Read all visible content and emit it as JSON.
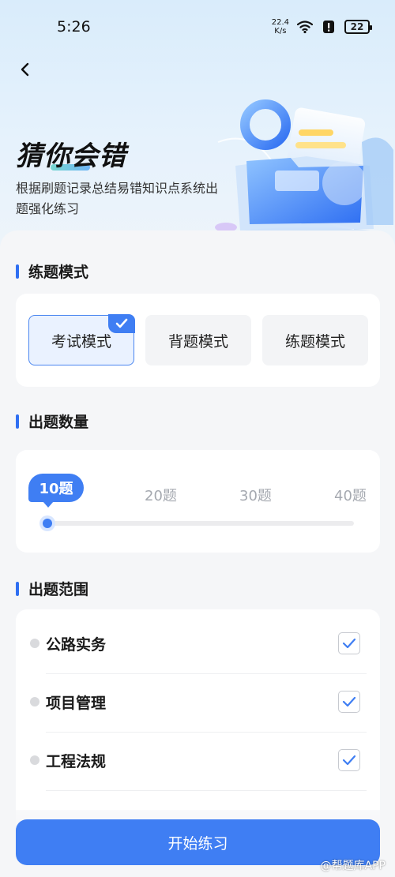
{
  "status_bar": {
    "time": "5:26",
    "net_speed_value": "22.4",
    "net_speed_unit": "K/s",
    "battery": "22"
  },
  "header": {
    "back_icon": "chevron-left-icon",
    "title": "猜你会错",
    "subtitle": "根据刷题记录总结易错知识点系统出题强化练习"
  },
  "practice_mode": {
    "title": "练题模式",
    "options": [
      "考试模式",
      "背题模式",
      "练题模式"
    ],
    "selected": "考试模式"
  },
  "question_count": {
    "title": "出题数量",
    "options": [
      "10题",
      "20题",
      "30题",
      "40题"
    ],
    "selected": "10题"
  },
  "question_scope": {
    "title": "出题范围",
    "items": [
      {
        "label": "公路实务",
        "checked": true
      },
      {
        "label": "项目管理",
        "checked": true
      },
      {
        "label": "工程法规",
        "checked": true
      }
    ]
  },
  "footer": {
    "start_button": "开始练习",
    "watermark": "@帮题库APP"
  },
  "colors": {
    "accent": "#3f7ef3",
    "selected_bg": "#eaf2ff",
    "page_bg": "#f5f6f8"
  }
}
